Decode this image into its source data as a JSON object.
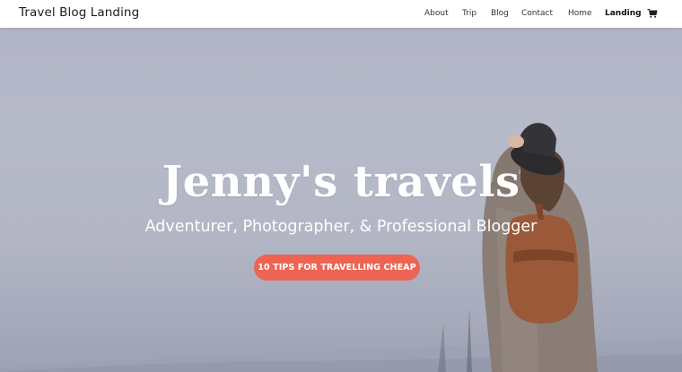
{
  "header": {
    "site_title": "Travel Blog Landing",
    "nav": [
      {
        "label": "About"
      },
      {
        "label": "Trip"
      },
      {
        "label": "Blog"
      },
      {
        "label": "Contact"
      },
      {
        "label": "Home"
      },
      {
        "label": "Landing",
        "active": true
      }
    ],
    "cart_icon": "shopping-cart-icon"
  },
  "hero": {
    "title": "Jenny's travels",
    "subtitle": "Adventurer, Photographer, & Professional Blogger",
    "cta_label": "10 TIPS FOR TRAVELLING CHEAP",
    "cta_color": "#ee6452"
  }
}
